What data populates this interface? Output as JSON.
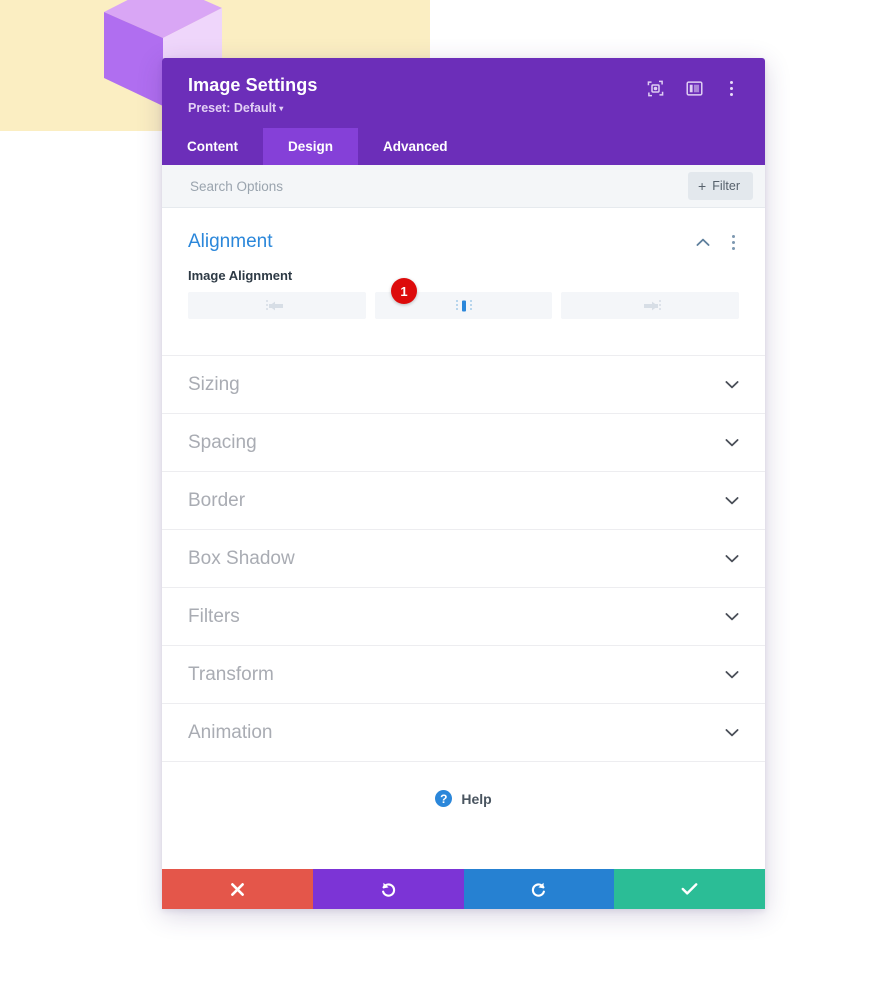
{
  "background": {
    "panel_color": "#fbeec2",
    "cube_light": "#d9a6f5",
    "cube_mid": "#c27ef0",
    "cube_dark": "#a855e8",
    "cube_face": "#efd6fb"
  },
  "modal": {
    "title": "Image Settings",
    "preset_label": "Preset: Default",
    "preset_caret": "▾",
    "header_color": "#6c2eb9",
    "header_icons": [
      {
        "name": "focus-icon",
        "label": "focus"
      },
      {
        "name": "layout-panel-icon",
        "label": "layout"
      },
      {
        "name": "more-vertical-icon",
        "label": "more"
      }
    ],
    "tabs": [
      {
        "label": "Content",
        "active": false
      },
      {
        "label": "Design",
        "active": true
      },
      {
        "label": "Advanced",
        "active": false
      }
    ],
    "active_tab_color": "#8540d8"
  },
  "search": {
    "placeholder": "Search Options",
    "value": "",
    "filter_plus": "+",
    "filter_label": "Filter"
  },
  "alignment_section": {
    "title": "Alignment",
    "accent_color": "#2b87da",
    "expanded": true,
    "field_label": "Image Alignment",
    "badge": "1",
    "badge_color": "#dd0b0b",
    "options": [
      {
        "name": "align-left",
        "label": "Left",
        "selected": false
      },
      {
        "name": "align-center",
        "label": "Center",
        "selected": true
      },
      {
        "name": "align-right",
        "label": "Right",
        "selected": false
      }
    ]
  },
  "collapsed_sections": [
    {
      "label": "Sizing"
    },
    {
      "label": "Spacing"
    },
    {
      "label": "Border"
    },
    {
      "label": "Box Shadow"
    },
    {
      "label": "Filters"
    },
    {
      "label": "Transform"
    },
    {
      "label": "Animation"
    }
  ],
  "help": {
    "icon_glyph": "?",
    "label": "Help",
    "color": "#2b87da"
  },
  "footer_buttons": [
    {
      "name": "cancel-button",
      "icon": "close-icon",
      "color": "#e4564a"
    },
    {
      "name": "undo-button",
      "icon": "undo-icon",
      "color": "#7c34d6"
    },
    {
      "name": "redo-button",
      "icon": "redo-icon",
      "color": "#2681d2"
    },
    {
      "name": "save-button",
      "icon": "check-icon",
      "color": "#2bbd96"
    }
  ]
}
